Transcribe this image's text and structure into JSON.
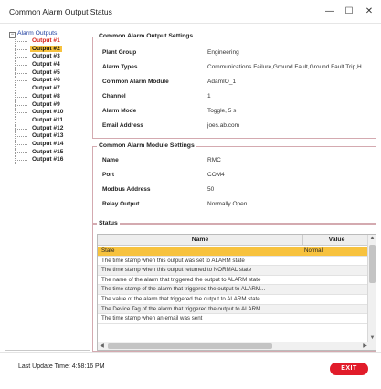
{
  "window": {
    "title": "Common Alarm Output Status",
    "minimize": "—",
    "maximize": "☐",
    "close": "✕"
  },
  "tree": {
    "root_label": "Alarm Outputs",
    "expander": "−",
    "items": [
      {
        "label": "Output #1",
        "state": "active"
      },
      {
        "label": "Output #2",
        "state": "selected"
      },
      {
        "label": "Output #3",
        "state": "normal"
      },
      {
        "label": "Output #4",
        "state": "normal"
      },
      {
        "label": "Output #5",
        "state": "normal"
      },
      {
        "label": "Output #6",
        "state": "normal"
      },
      {
        "label": "Output #7",
        "state": "normal"
      },
      {
        "label": "Output #8",
        "state": "normal"
      },
      {
        "label": "Output #9",
        "state": "normal"
      },
      {
        "label": "Output #10",
        "state": "normal"
      },
      {
        "label": "Output #11",
        "state": "normal"
      },
      {
        "label": "Output #12",
        "state": "normal"
      },
      {
        "label": "Output #13",
        "state": "normal"
      },
      {
        "label": "Output #14",
        "state": "normal"
      },
      {
        "label": "Output #15",
        "state": "normal"
      },
      {
        "label": "Output #16",
        "state": "normal"
      }
    ]
  },
  "output_settings": {
    "heading": "Common Alarm Output Settings",
    "rows": [
      {
        "key": "Plant Group",
        "value": "Engineering"
      },
      {
        "key": "Alarm Types",
        "value": "Communications Failure,Ground Fault,Ground Fault Trip,H"
      },
      {
        "key": "Common Alarm Module",
        "value": "AdamIO_1"
      },
      {
        "key": "Channel",
        "value": "1"
      },
      {
        "key": "Alarm Mode",
        "value": "Toggle, 5 s"
      },
      {
        "key": "Email Address",
        "value": "joes.ab.com"
      }
    ]
  },
  "module_settings": {
    "heading": "Common Alarm Module Settings",
    "rows": [
      {
        "key": "Name",
        "value": "RMC"
      },
      {
        "key": "Port",
        "value": "COM4"
      },
      {
        "key": "Modbus Address",
        "value": "50"
      },
      {
        "key": "Relay Output",
        "value": "Normally Open"
      }
    ]
  },
  "status": {
    "heading": "Status",
    "col_name": "Name",
    "col_value": "Value",
    "rows": [
      {
        "name": "State",
        "value": "Normal"
      },
      {
        "name": "The time stamp when this output was set to ALARM state",
        "value": ""
      },
      {
        "name": "The time stamp when this output returned to NORMAL state",
        "value": ""
      },
      {
        "name": "The name of the alarm that triggered the output to ALARM state",
        "value": ""
      },
      {
        "name": "The time stamp of the alarm that triggered the output to ALARM...",
        "value": ""
      },
      {
        "name": "The value of the alarm that triggered the output to ALARM state",
        "value": ""
      },
      {
        "name": "The Device Tag of the alarm that triggered the output to ALARM ...",
        "value": ""
      },
      {
        "name": "The time stamp when an email was sent",
        "value": ""
      }
    ],
    "scroll_up": "▲",
    "scroll_down": "▼",
    "scroll_left": "◀",
    "scroll_right": "▶"
  },
  "footer": {
    "last_update": "Last Update Time: 4:58:16 PM",
    "exit_label": "EXIT"
  },
  "colors": {
    "accent": "#e11c2a",
    "selection": "#f7c23e",
    "tree_active": "#d8221b",
    "group_border": "#d4aab0"
  }
}
